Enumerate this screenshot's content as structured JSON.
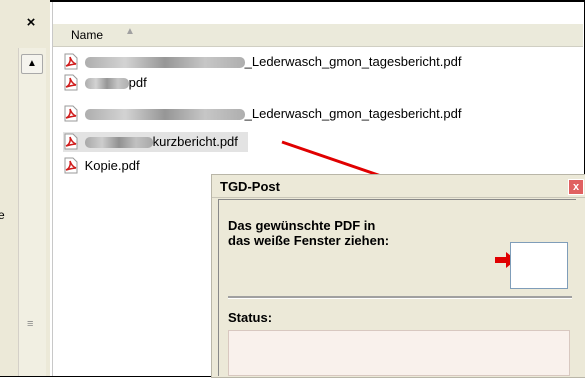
{
  "panel": {
    "close_label": "×",
    "scroll_up_label": "▲",
    "edge_char": "e",
    "scroll_grip": "≡"
  },
  "header": {
    "name_label": "Name",
    "sort_icon": "sort-ascending-icon"
  },
  "files": [
    {
      "visible_text": "_Lederwasch_gmon_tagesbericht.pdf"
    },
    {
      "visible_text": "pdf"
    },
    {
      "visible_text": "_Lederwasch_gmon_tagesbericht.pdf"
    },
    {
      "visible_text": "kurzbericht.pdf"
    },
    {
      "visible_text": "Kopie.pdf"
    }
  ],
  "dialog": {
    "title": "TGD-Post",
    "close_label": "x",
    "instruction_line1": "Das gewünschte PDF in",
    "instruction_line2": "das weiße Fenster ziehen:",
    "status_label": "Status:",
    "status_value": ""
  },
  "colors": {
    "arrow": "#e00000",
    "pdf_icon": "#d01c1c",
    "status_box": "#f9f1ec",
    "dialog_bg": "#ece9d8"
  }
}
